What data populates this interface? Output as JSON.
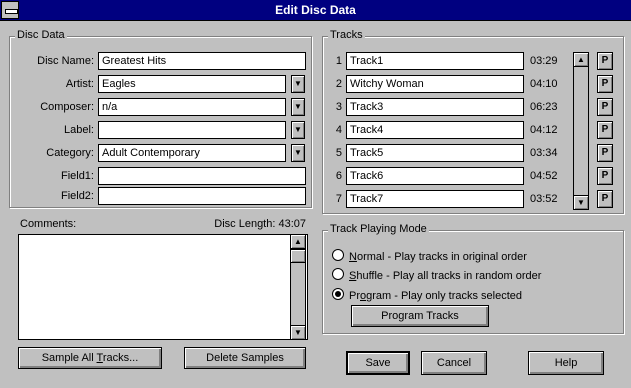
{
  "window": {
    "title": "Edit Disc Data"
  },
  "disc_data": {
    "group_label": "Disc Data",
    "fields": [
      {
        "label": "Disc Name:",
        "value": "Greatest Hits",
        "has_dropdown": false
      },
      {
        "label": "Artist:",
        "value": "Eagles",
        "has_dropdown": true
      },
      {
        "label": "Composer:",
        "value": "n/a",
        "has_dropdown": true
      },
      {
        "label": "Label:",
        "value": "",
        "has_dropdown": true
      },
      {
        "label": "Category:",
        "value": "Adult Contemporary",
        "has_dropdown": true
      },
      {
        "label": "Field1:",
        "value": "",
        "has_dropdown": false
      },
      {
        "label": "Field2:",
        "value": "",
        "has_dropdown": false
      }
    ],
    "comments_label": "Comments:",
    "disc_length_label": "Disc Length: 43:07",
    "comments_value": ""
  },
  "tracks": {
    "group_label": "Tracks",
    "items": [
      {
        "number": "1",
        "name": "Track1",
        "duration": "03:29",
        "program_label": "P"
      },
      {
        "number": "2",
        "name": "Witchy Woman",
        "duration": "04:10",
        "program_label": "P"
      },
      {
        "number": "3",
        "name": "Track3",
        "duration": "06:23",
        "program_label": "P"
      },
      {
        "number": "4",
        "name": "Track4",
        "duration": "04:12",
        "program_label": "P"
      },
      {
        "number": "5",
        "name": "Track5",
        "duration": "03:34",
        "program_label": "P"
      },
      {
        "number": "6",
        "name": "Track6",
        "duration": "04:52",
        "program_label": "P"
      },
      {
        "number": "7",
        "name": "Track7",
        "duration": "03:52",
        "program_label": "P"
      }
    ]
  },
  "track_mode": {
    "group_label": "Track Playing Mode",
    "options": [
      {
        "prefix": "",
        "key": "N",
        "rest": "ormal - Play tracks in original order",
        "selected": false
      },
      {
        "prefix": "",
        "key": "S",
        "rest": "huffle - Play all tracks in random order",
        "selected": false
      },
      {
        "prefix": "Pr",
        "key": "o",
        "rest": "gram - Play only tracks selected",
        "selected": true
      }
    ],
    "program_button": "Program Tracks"
  },
  "buttons": {
    "sample_all_prefix": "Sample All ",
    "sample_all_key": "T",
    "sample_all_rest": "racks...",
    "delete_samples": "Delete Samples",
    "save": "Save",
    "cancel": "Cancel",
    "help": "Help"
  },
  "icons": {
    "dropdown": "down-arrow-icon",
    "scroll_up": "up-arrow-icon",
    "scroll_down": "down-arrow-icon"
  }
}
